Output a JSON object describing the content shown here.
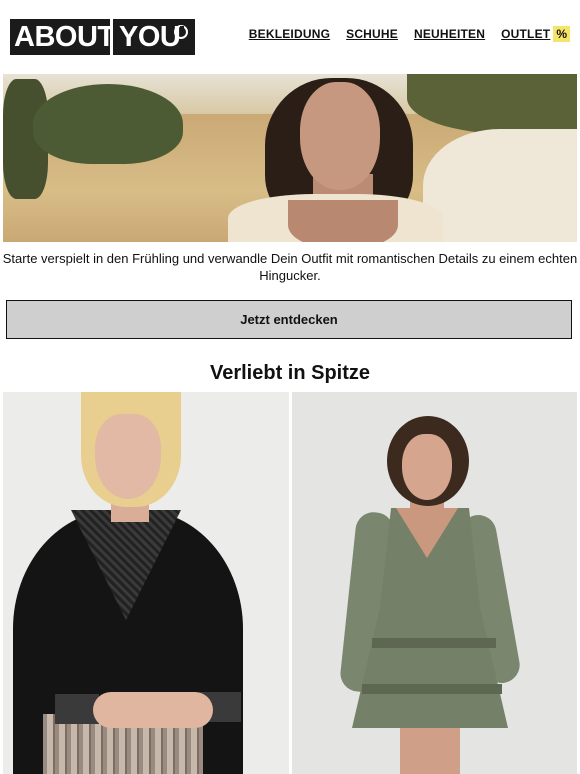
{
  "header": {
    "logo": {
      "part1": "ABOUT",
      "part2": "YOU"
    },
    "nav": [
      {
        "label": "BEKLEIDUNG"
      },
      {
        "label": "SCHUHE"
      },
      {
        "label": "NEUHEITEN"
      },
      {
        "label": "OUTLET",
        "badge": "%"
      }
    ]
  },
  "intro": {
    "text": "Starte verspielt in den Frühling und verwandle Dein Outfit mit romantischen Details zu einem echten Hingucker."
  },
  "cta": {
    "label": "Jetzt entdecken"
  },
  "section": {
    "title": "Verliebt in Spitze"
  },
  "colors": {
    "accent": "#f5e46a",
    "button_bg": "#cfcfcf",
    "logo_bg": "#1b1b1b"
  }
}
